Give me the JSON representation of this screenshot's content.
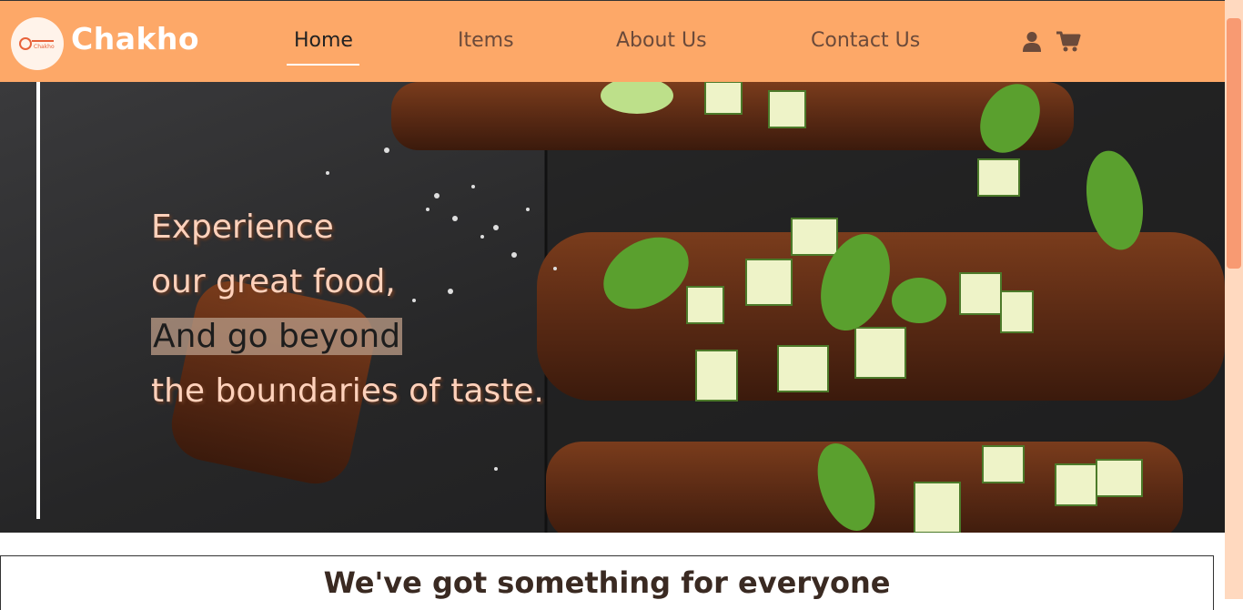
{
  "brand": {
    "name": "Chakho",
    "logo_text": "Chakho"
  },
  "nav": {
    "links": [
      {
        "label": "Home",
        "active": true
      },
      {
        "label": "Items",
        "active": false
      },
      {
        "label": "About Us",
        "active": false
      },
      {
        "label": "Contact Us",
        "active": false
      }
    ],
    "icons": [
      "user-icon",
      "cart-icon"
    ]
  },
  "hero": {
    "lines": [
      "Experience",
      "our great food,",
      "And go beyond",
      "the boundaries of taste."
    ],
    "highlighted_line": "And go beyond"
  },
  "section": {
    "title": "We've got something for everyone"
  },
  "colors": {
    "navbar": "#fda868",
    "hero_text": "#ffd1bb",
    "section_title": "#3a2a22"
  }
}
